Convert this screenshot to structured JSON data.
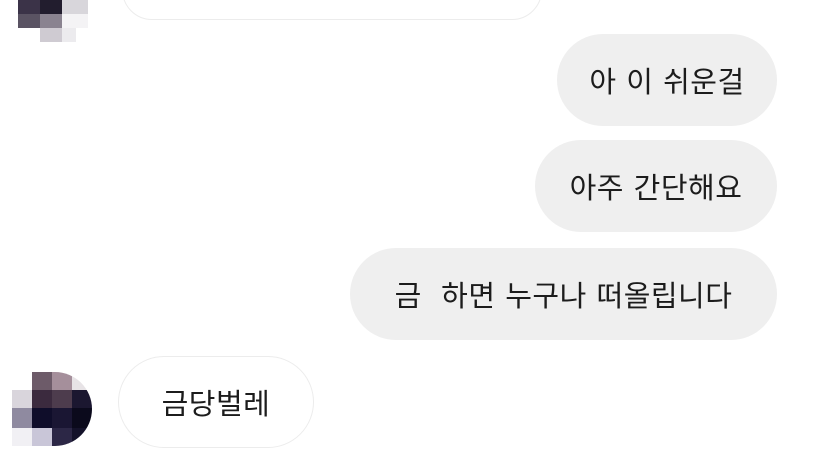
{
  "conversation": {
    "messages": [
      {
        "sender": "other",
        "text": ""
      },
      {
        "sender": "me",
        "text": "아 이 쉬운걸"
      },
      {
        "sender": "me",
        "text": "아주 간단해요"
      },
      {
        "sender": "me",
        "text": "금  하면 누구나 떠올립니다"
      },
      {
        "sender": "other",
        "text": "금당벌레"
      }
    ],
    "avatar_style": "pixelated",
    "colors": {
      "outgoing_bubble": "#efefef",
      "incoming_bubble": "#ffffff",
      "text": "#1c1c1c"
    }
  }
}
